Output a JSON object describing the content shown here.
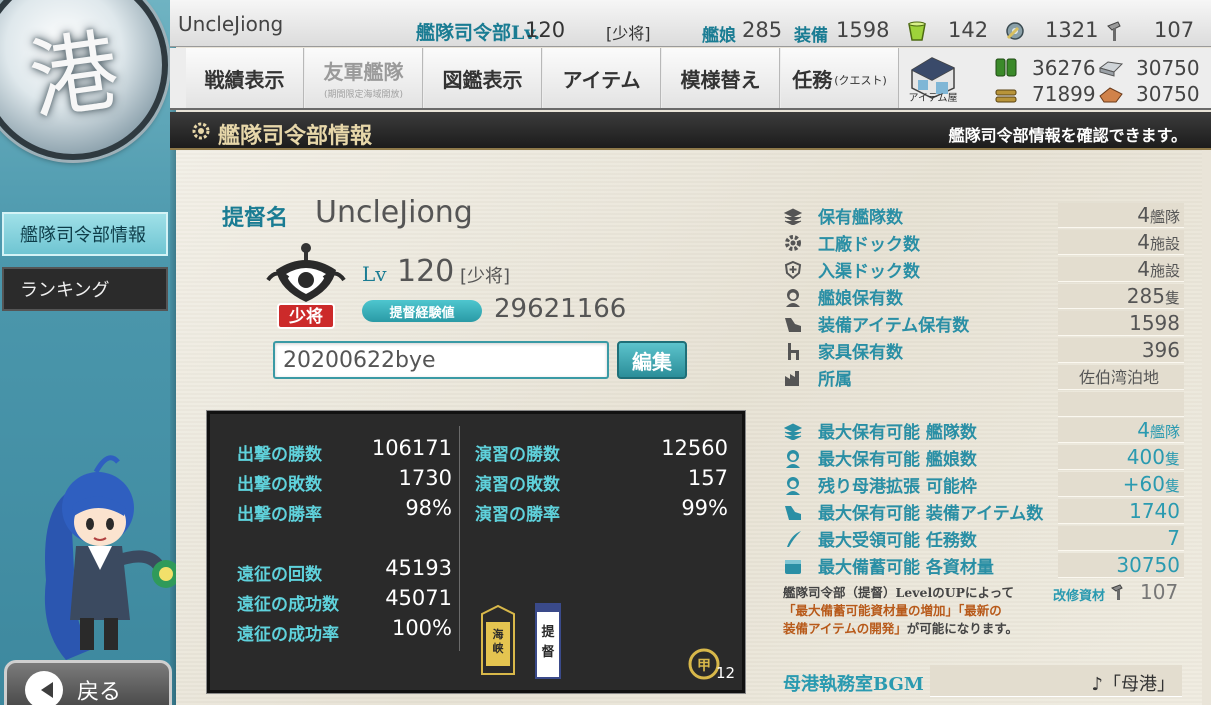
{
  "header": {
    "player_name": "UncleJiong",
    "hq_title": "艦隊司令部Lv.",
    "hq_level": "120",
    "hq_rank": "[少将]",
    "ships_label": "艦娘",
    "ships_count": "285",
    "equip_label": "装備",
    "equip_count": "1598",
    "bucket": "142",
    "dev_material": "1321",
    "improve_material": "107"
  },
  "nav": {
    "items": [
      {
        "label": "戦績表示"
      },
      {
        "label": "友軍艦隊",
        "sub": "(期間限定海域開放)"
      },
      {
        "label": "図鑑表示"
      },
      {
        "label": "アイテム"
      },
      {
        "label": "模様替え"
      },
      {
        "label": "任務",
        "sub": "(クエスト)"
      }
    ],
    "shop_label": "アイテム屋"
  },
  "materials": {
    "fuel": "36276",
    "steel": "30750",
    "ammo": "71899",
    "bauxite": "30750"
  },
  "section": {
    "title": "艦隊司令部情報",
    "hint": "艦隊司令部情報を確認できます。"
  },
  "sidebar": {
    "items": [
      {
        "label": "艦隊司令部情報"
      },
      {
        "label": "ランキング"
      }
    ],
    "back_label": "戻る"
  },
  "profile": {
    "admiral_label": "提督名",
    "admiral_name": "UncleJiong",
    "rank_badge": "少将",
    "lv_label": "Lv",
    "lv_value": "120",
    "lv_rank": "[少将]",
    "exp_label": "提督経験値",
    "exp_value": "29621166",
    "comment": "20200622bye",
    "edit_label": "編集"
  },
  "battle_stats": {
    "left": [
      {
        "label": "出撃の勝数",
        "value": "106171"
      },
      {
        "label": "出撃の敗数",
        "value": "1730"
      },
      {
        "label": "出撃の勝率",
        "value": "98%"
      },
      {
        "label": "遠征の回数",
        "value": "45193"
      },
      {
        "label": "遠征の成功数",
        "value": "45071"
      },
      {
        "label": "遠征の成功率",
        "value": "100%"
      }
    ],
    "right": [
      {
        "label": "演習の勝数",
        "value": "12560"
      },
      {
        "label": "演習の敗数",
        "value": "157"
      },
      {
        "label": "演習の勝率",
        "value": "99%"
      }
    ],
    "medal_count": "12"
  },
  "info": {
    "rows": [
      {
        "label": "保有艦隊数",
        "value": "4",
        "unit": "艦隊"
      },
      {
        "label": "工廠ドック数",
        "value": "4",
        "unit": "施設"
      },
      {
        "label": "入渠ドック数",
        "value": "4",
        "unit": "施設"
      },
      {
        "label": "艦娘保有数",
        "value": "285",
        "unit": "隻"
      },
      {
        "label": "装備アイテム保有数",
        "value": "1598",
        "unit": ""
      },
      {
        "label": "家具保有数",
        "value": "396",
        "unit": ""
      },
      {
        "label": "所属",
        "value": "佐伯湾泊地",
        "unit": ""
      }
    ],
    "max_rows": [
      {
        "label": "最大保有可能 艦隊数",
        "value": "4",
        "unit": "艦隊"
      },
      {
        "label": "最大保有可能 艦娘数",
        "value": "400",
        "unit": "隻"
      },
      {
        "label": "残り母港拡張 可能枠",
        "value": "+60",
        "unit": "隻"
      },
      {
        "label": "最大保有可能 装備アイテム数",
        "value": "1740",
        "unit": ""
      },
      {
        "label": "最大受領可能 任務数",
        "value": "7",
        "unit": ""
      },
      {
        "label": "最大備蓄可能 各資材量",
        "value": "30750",
        "unit": ""
      }
    ],
    "note_1": "艦隊司令部（提督）LevelのUPによって",
    "note_2": "「最大備蓄可能資材量の増加」「最新の",
    "note_3": "装備アイテムの開発」",
    "note_4": "が可能になります。",
    "kaishu_label": "改修資材",
    "kaishu_value": "107",
    "bgm_label": "母港執務室BGM",
    "bgm_value": "♪「母港」"
  },
  "colors": {
    "teal_label": "#2a8fa5",
    "stats_label": "#5fd2dc",
    "header_gold": "#e7d7a9"
  }
}
